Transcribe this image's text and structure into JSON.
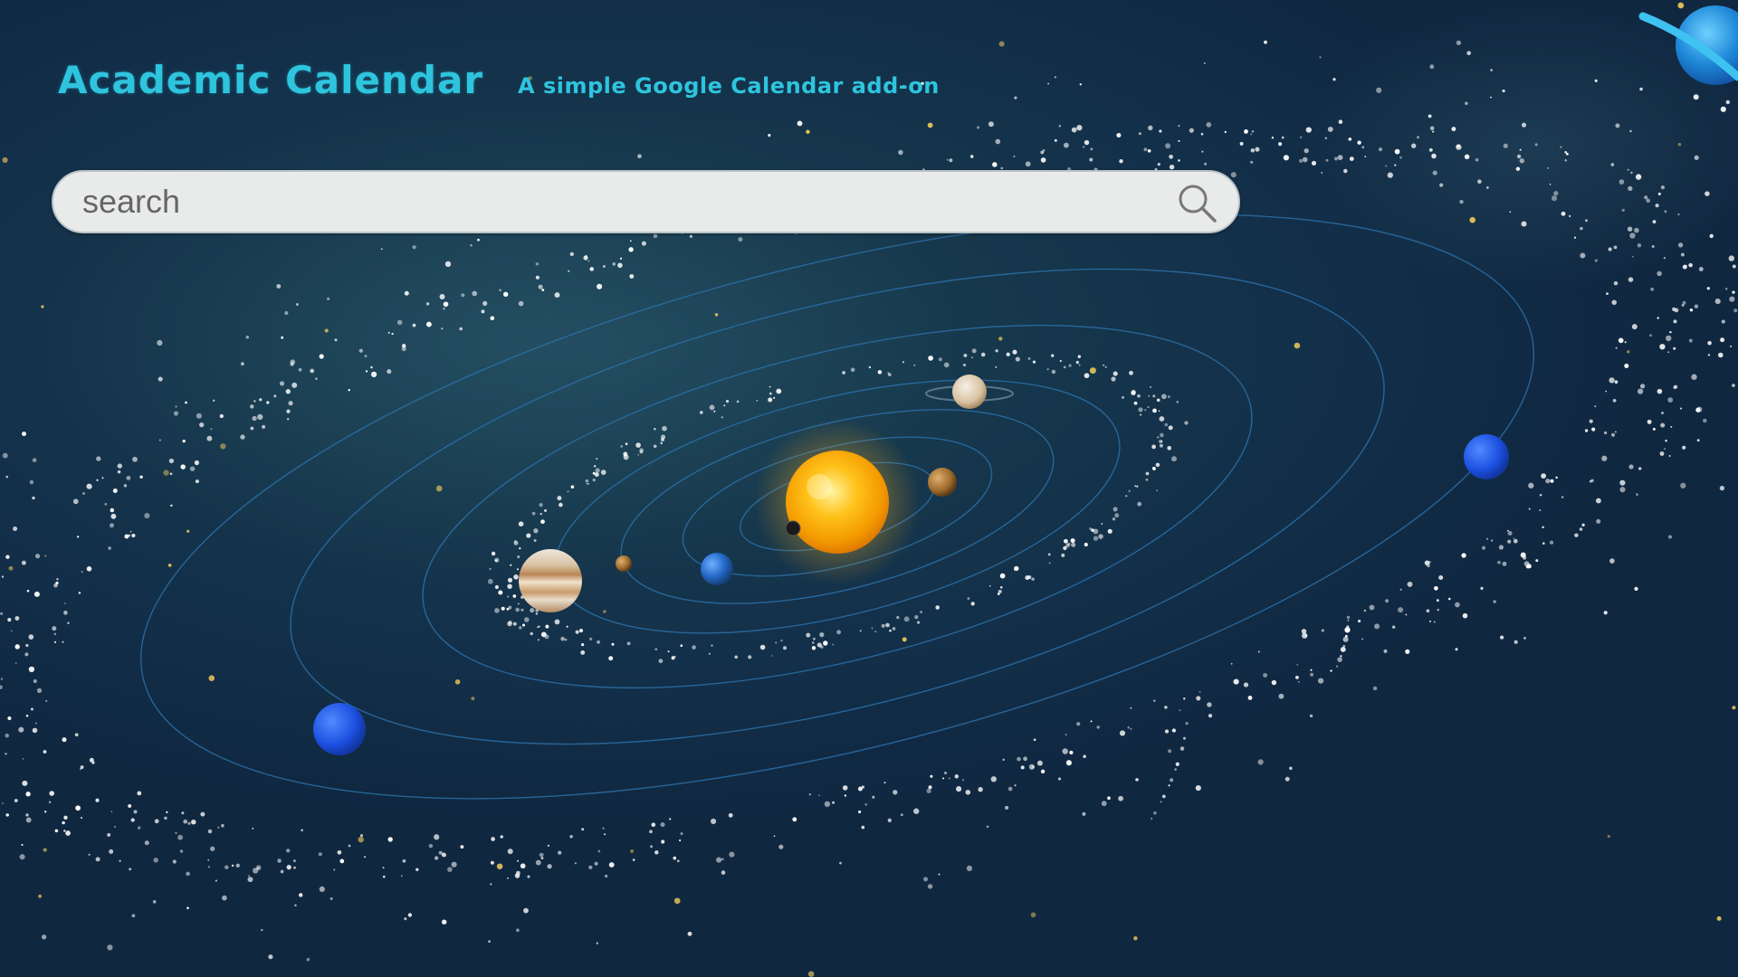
{
  "header": {
    "title": "Academic Calendar",
    "subtitle": "A simple Google Calendar add-on"
  },
  "search": {
    "placeholder": "search",
    "value": "",
    "icon": "search-icon"
  },
  "decorations": {
    "corner_icon": "ringed-planet-icon",
    "scene": "solar-system-illustration"
  },
  "colors": {
    "accent": "#2ec4de",
    "background": "#13304a",
    "search_bg": "#e9ebeb"
  }
}
